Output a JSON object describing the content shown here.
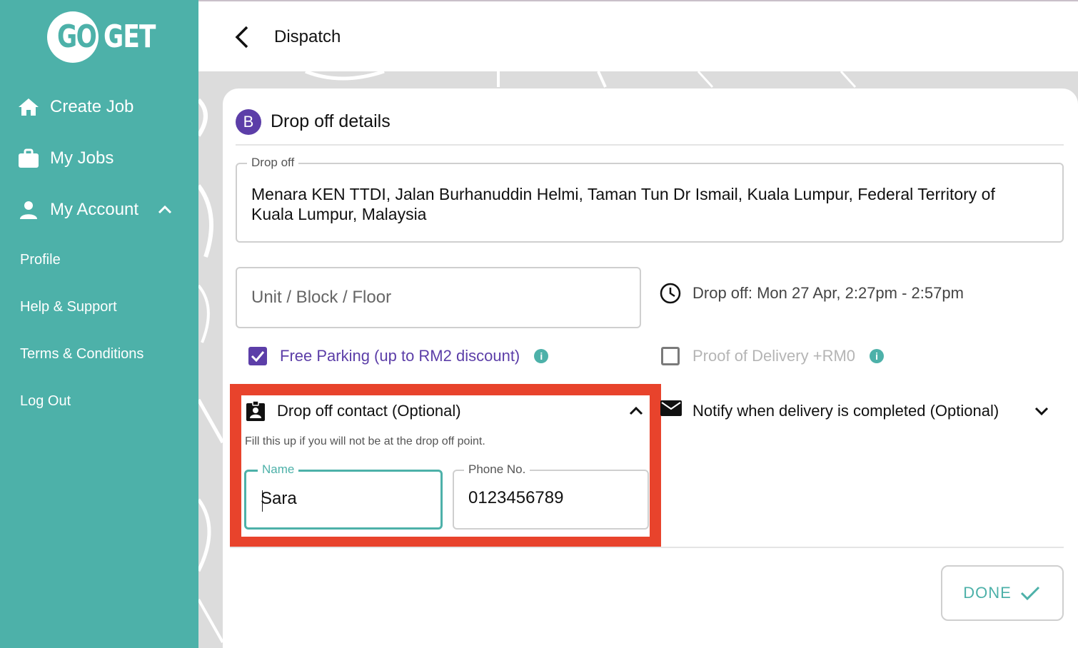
{
  "brand": {
    "logo_left": "GO",
    "logo_right": "GET",
    "accent_color": "#4db1a9",
    "highlight_color": "#e8432c",
    "badge_color": "#5c3ea8"
  },
  "sidebar": {
    "items": [
      {
        "label": "Create Job",
        "icon": "home-icon"
      },
      {
        "label": "My Jobs",
        "icon": "briefcase-icon"
      },
      {
        "label": "My Account",
        "icon": "person-icon",
        "expanded": true
      }
    ],
    "sub_items": [
      {
        "label": "Profile"
      },
      {
        "label": "Help & Support"
      },
      {
        "label": "Terms & Conditions"
      },
      {
        "label": "Log Out"
      }
    ]
  },
  "header": {
    "title": "Dispatch"
  },
  "card": {
    "badge": "B",
    "title": "Drop off details",
    "address": {
      "legend": "Drop off",
      "value": "Menara KEN TTDI, Jalan Burhanuddin Helmi, Taman Tun Dr Ismail, Kuala Lumpur, Federal Territory of Kuala Lumpur, Malaysia"
    },
    "unit": {
      "placeholder": "Unit / Block / Floor",
      "value": ""
    },
    "time": {
      "text": "Drop off: Mon 27 Apr, 2:27pm - 2:57pm"
    },
    "free_parking": {
      "label": "Free Parking (up to RM2 discount)",
      "checked": true
    },
    "proof_of_delivery": {
      "label": "Proof of Delivery +RM0",
      "checked": false
    },
    "contact": {
      "title": "Drop off contact (Optional)",
      "help": "Fill this up if you will not be at the drop off point.",
      "name_label": "Name",
      "name_value": "Sara",
      "phone_label": "Phone No.",
      "phone_value": "0123456789"
    },
    "notify": {
      "label": "Notify when delivery is completed (Optional)"
    },
    "done_label": "DONE"
  }
}
